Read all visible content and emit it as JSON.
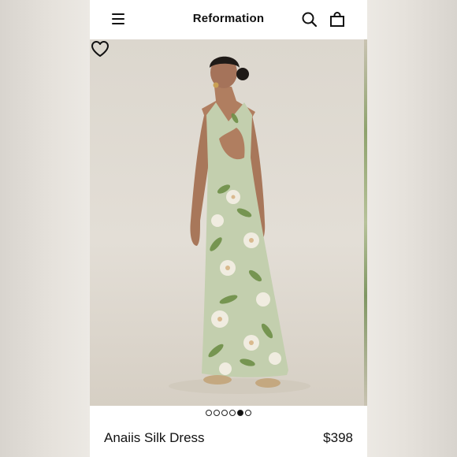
{
  "header": {
    "brand": "Reformation",
    "icons": [
      "menu-icon",
      "search-icon",
      "bag-icon"
    ]
  },
  "gallery": {
    "image_count": 6,
    "active_index": 4,
    "favorite_icon": "heart-icon"
  },
  "product": {
    "name": "Anaiis Silk Dress",
    "price": "$398"
  },
  "colors": {
    "dress_base": "#c3cfae",
    "leaf": "#6e8f47",
    "flower": "#f0ece0",
    "background": "#e3ded6"
  }
}
